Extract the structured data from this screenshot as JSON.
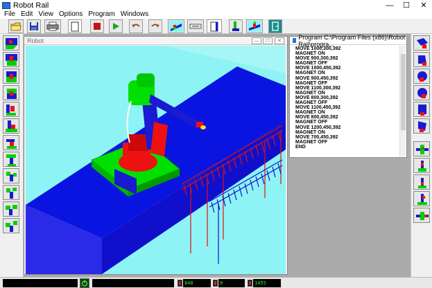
{
  "window": {
    "title": "Robot Rail",
    "controls": {
      "minimize": "—",
      "maximize": "☐",
      "close": "✕"
    }
  },
  "menu": [
    "File",
    "Edit",
    "View",
    "Options",
    "Program",
    "Windows"
  ],
  "toolbar": {
    "icons": [
      "open-folder-icon",
      "save-disk-icon",
      "print-icon",
      "blank-page-icon",
      "stop-icon",
      "play-icon",
      "undo-icon",
      "redo-icon",
      "robot-view-icon",
      "rail-tool-icon",
      "document-icon",
      "robot-arm-icon",
      "robot-rail-icon",
      "exit-icon"
    ]
  },
  "robot_window": {
    "title": "Robot",
    "controls": [
      "—",
      "☐",
      "✕"
    ]
  },
  "program_window": {
    "title": "Program C:\\Program Files (x86)\\Robot Rail\\progra...",
    "lines": [
      "MOVE 1000,300,392",
      "MAGNET ON",
      "MOVE 900,300,392",
      "MAGNET OFF",
      "MOVE 1000,450,392",
      "MAGNET ON",
      "MOVE 900,450,392",
      "MAGNET OFF",
      "MOVE 1100,300,392",
      "MAGNET ON",
      "MOVE 800,300,392",
      "MAGNET OFF",
      "MOVE 1100,450,392",
      "MAGNET ON",
      "MOVE 800,450,392",
      "MAGNET OFF",
      "MOVE 1200,450,392",
      "MAGNET ON",
      "MOVE 700,450,392",
      "MAGNET OFF",
      "END"
    ]
  },
  "status": {
    "x": "840",
    "y": "0",
    "z": "1455"
  },
  "colors": {
    "floor": "#8ef3f5",
    "rail": "#0a14e0",
    "robot_base": "#00e000",
    "robot_red": "#ee1111",
    "robot_blue": "#1a1ad0",
    "rack_red": "#e01010",
    "rack_blue": "#1010d0"
  }
}
